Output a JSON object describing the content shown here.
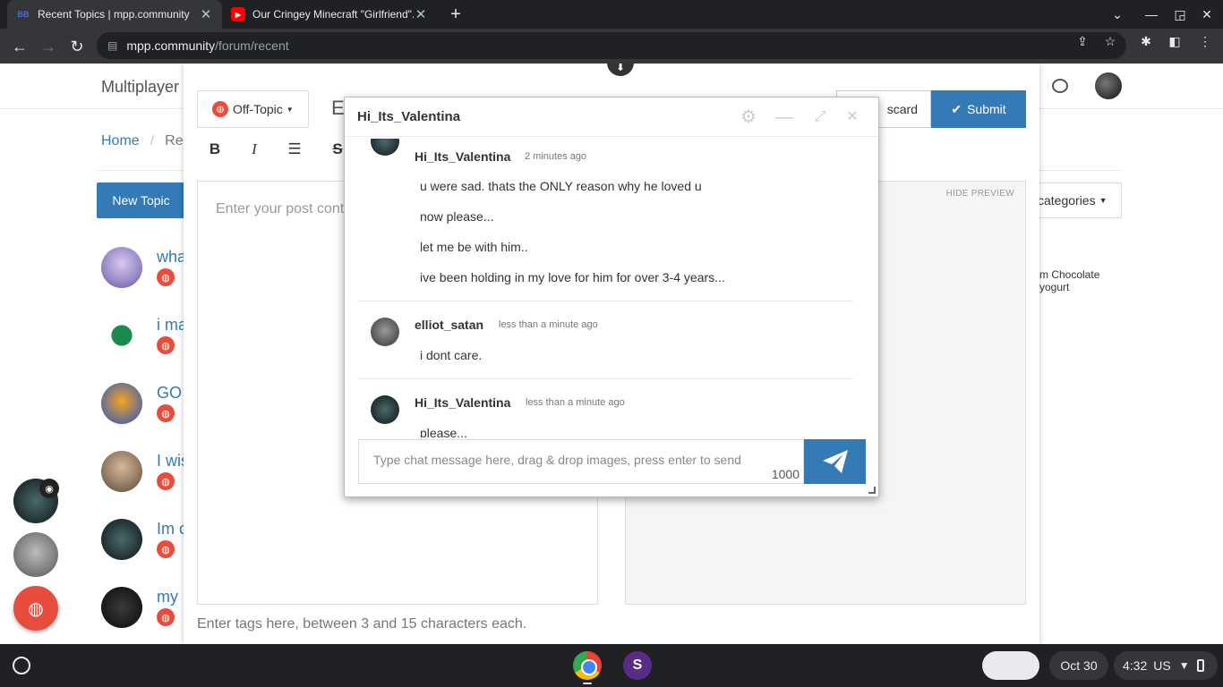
{
  "browser": {
    "tabs": [
      {
        "title": "Recent Topics | mpp.community",
        "favicon": "BB"
      },
      {
        "title": "Our Cringey Minecraft \"Girlfriend\"...",
        "favicon": "yt"
      }
    ],
    "url_host": "mpp.community",
    "url_path": "/forum/recent"
  },
  "site": {
    "brand": "Multiplayer",
    "breadcrumb_home": "Home",
    "breadcrumb_sep": "/",
    "breadcrumb_current": "Rec",
    "new_topic": "New Topic",
    "categories_label": "categories",
    "sidebar_lines": [
      "m Chocolate",
      "yogurt"
    ],
    "topics": [
      {
        "title": "wha"
      },
      {
        "title": "i ma"
      },
      {
        "title": "GO"
      },
      {
        "title": "I wis"
      },
      {
        "title": "Im c"
      },
      {
        "title": "my"
      }
    ]
  },
  "composer": {
    "category": "Off-Topic",
    "title_prefix": "E",
    "discard": "scard",
    "submit": "Submit",
    "editor_placeholder": "Enter your post conte",
    "hide_preview": "HIDE PREVIEW",
    "tags_placeholder": "Enter tags here, between 3 and 15 characters each."
  },
  "chat": {
    "title": "Hi_Its_Valentina",
    "messages": [
      {
        "user": "Hi_Its_Valentina",
        "time": "2 minutes ago",
        "lines": [
          "u were sad. thats the ONLY reason why he loved u",
          "now please...",
          "let me be with him..",
          "ive been holding in my love for him for over 3-4 years..."
        ]
      },
      {
        "user": "elliot_satan",
        "time": "less than a minute ago",
        "lines": [
          "i dont care."
        ]
      },
      {
        "user": "Hi_Its_Valentina",
        "time": "less than a minute ago",
        "lines": [
          "please..."
        ]
      }
    ],
    "input_placeholder": "Type chat message here, drag & drop images, press enter to send",
    "char_count": "1000"
  },
  "shelf": {
    "date": "Oct 30",
    "time": "4:32",
    "locale": "US"
  },
  "colors": {
    "accent": "#337ab7",
    "category": "#e74c3c",
    "chrome_dark": "#202124"
  }
}
